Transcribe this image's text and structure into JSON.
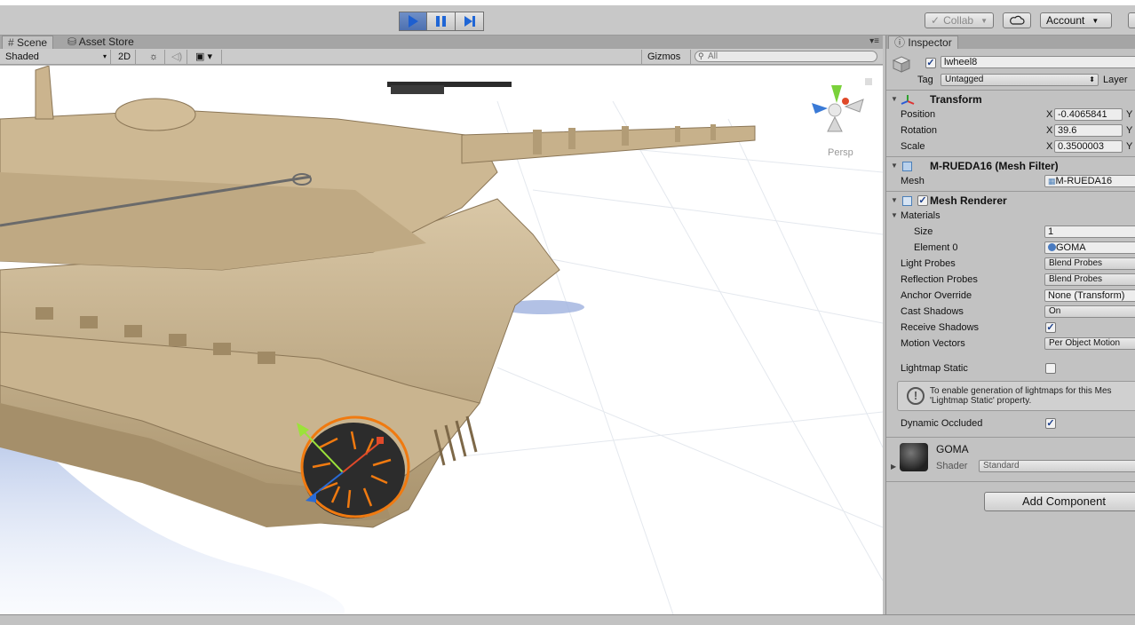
{
  "toolbar": {
    "play": "play-icon",
    "pause": "pause-icon",
    "step": "step-icon",
    "collab_label": "Collab",
    "account_label": "Account",
    "cloud_icon": "cloud-icon",
    "accent": "#4d70b0"
  },
  "scene": {
    "tabs": [
      {
        "label": "Scene"
      },
      {
        "label": "Asset Store"
      }
    ],
    "shading_mode": "Shaded",
    "mode_2d": "2D",
    "gizmos_label": "Gizmos",
    "search_placeholder": "All",
    "view_label": "Persp",
    "selection_color": "#f07a10"
  },
  "inspector": {
    "tab_label": "Inspector",
    "object_name": "lwheel8",
    "object_active": true,
    "tag_label": "Tag",
    "tag_value": "Untagged",
    "layer_label": "Layer",
    "transform": {
      "title": "Transform",
      "position_label": "Position",
      "position_x": "-0.4065841",
      "rotation_label": "Rotation",
      "rotation_x": "39.6",
      "scale_label": "Scale",
      "scale_x": "0.3500003",
      "x_label": "X",
      "y_label": "Y"
    },
    "mesh_filter": {
      "title": "M-RUEDA16 (Mesh Filter)",
      "mesh_label": "Mesh",
      "mesh_value": "M-RUEDA16"
    },
    "mesh_renderer": {
      "title": "Mesh Renderer",
      "enabled": true,
      "materials_label": "Materials",
      "size_label": "Size",
      "size_value": "1",
      "element0_label": "Element 0",
      "element0_value": "GOMA",
      "light_probes_label": "Light Probes",
      "light_probes_value": "Blend Probes",
      "reflection_probes_label": "Reflection Probes",
      "reflection_probes_value": "Blend Probes",
      "anchor_override_label": "Anchor Override",
      "anchor_override_value": "None (Transform)",
      "cast_shadows_label": "Cast Shadows",
      "cast_shadows_value": "On",
      "receive_shadows_label": "Receive Shadows",
      "receive_shadows": true,
      "motion_vectors_label": "Motion Vectors",
      "motion_vectors_value": "Per Object Motion",
      "lightmap_static_label": "Lightmap Static",
      "lightmap_static": false,
      "help_line1": "To enable generation of lightmaps for this Mes",
      "help_line2": "'Lightmap Static' property.",
      "dynamic_occluded_label": "Dynamic Occluded",
      "dynamic_occluded": true
    },
    "material": {
      "name": "GOMA",
      "shader_label": "Shader",
      "shader_value": "Standard"
    },
    "add_component_label": "Add Component"
  }
}
